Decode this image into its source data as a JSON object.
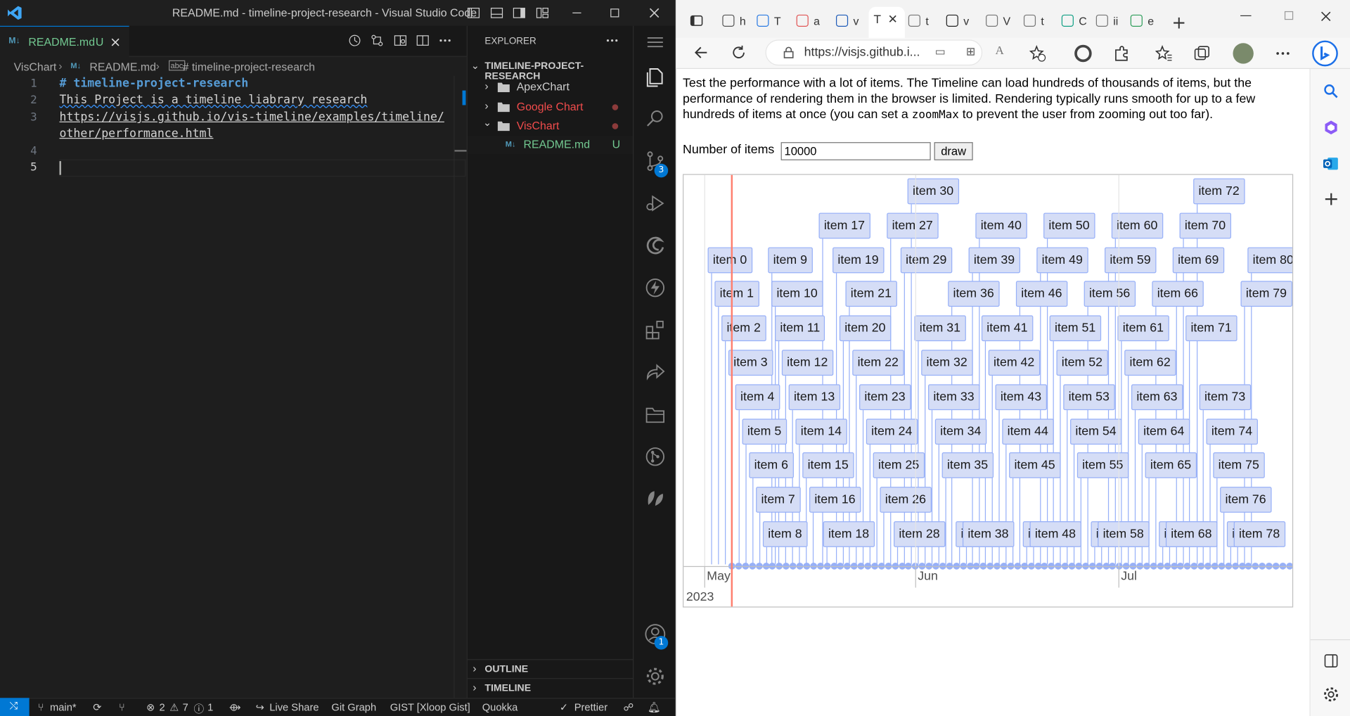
{
  "vscode": {
    "window_title": "README.md - timeline-project-research - Visual Studio Code",
    "tab": {
      "label": "README.md",
      "status": "U"
    },
    "breadcrumb": [
      "VisChart",
      "README.md",
      "# timeline-project-research"
    ],
    "lines": [
      {
        "num": "1",
        "text": "# timeline-project-research"
      },
      {
        "num": "2",
        "text": "This Project is a timeline liabrary research"
      },
      {
        "num": "3",
        "text": "https://visjs.github.io/vis-timeline/examples/timeline/"
      },
      {
        "num": "",
        "text": "other/performance.html"
      },
      {
        "num": "4",
        "text": ""
      },
      {
        "num": "5",
        "text": ""
      }
    ],
    "explorer": {
      "title": "EXPLORER",
      "root": "TIMELINE-PROJECT-RESEARCH",
      "items": [
        {
          "label": "ApexChart"
        },
        {
          "label": "Google Chart"
        },
        {
          "label": "VisChart"
        },
        {
          "label": "README.md",
          "status": "U"
        }
      ],
      "outline": "OUTLINE",
      "timeline": "TIMELINE"
    },
    "activity": {
      "scm_badge": "3",
      "account_badge": "1"
    },
    "status": {
      "branch": "main*",
      "errors": "2",
      "warnings": "7",
      "infos": "1",
      "live_share": "Live Share",
      "git_graph": "Git Graph",
      "gist": "GIST [Xloop Gist]",
      "quokka": "Quokka",
      "prettier": "Prettier"
    }
  },
  "browser": {
    "url": "https://visjs.github.i...",
    "tab_letters": [
      "h",
      "T",
      "a",
      "v",
      "T",
      "t",
      "v",
      "V",
      "t",
      "C",
      "ii",
      "e"
    ],
    "description": "Test the performance with a lot of items. The Timeline can load hundreds of thousands of items, but the performance of rendering them in the browser is limited. Rendering typically runs smooth for up to a few hundreds of items at once (you can set a",
    "code_word": "zoomMax",
    "description_end": "to prevent the user from zooming out too far).",
    "items_label": "Number of items",
    "items_value": "10000",
    "draw_label": "draw",
    "axis": {
      "months": [
        "May",
        "Jun",
        "Jul"
      ],
      "year": "2023"
    },
    "item_prefix": "item",
    "item_count_shown": 81
  },
  "colors": {
    "vscode_bg": "#1e1e1e",
    "accent": "#0078d4",
    "untracked": "#73c991",
    "modified": "#f14c4c",
    "item_fill": "#d5ddf6",
    "item_border": "#97b0f8",
    "current_time": "#ff7f6e"
  }
}
